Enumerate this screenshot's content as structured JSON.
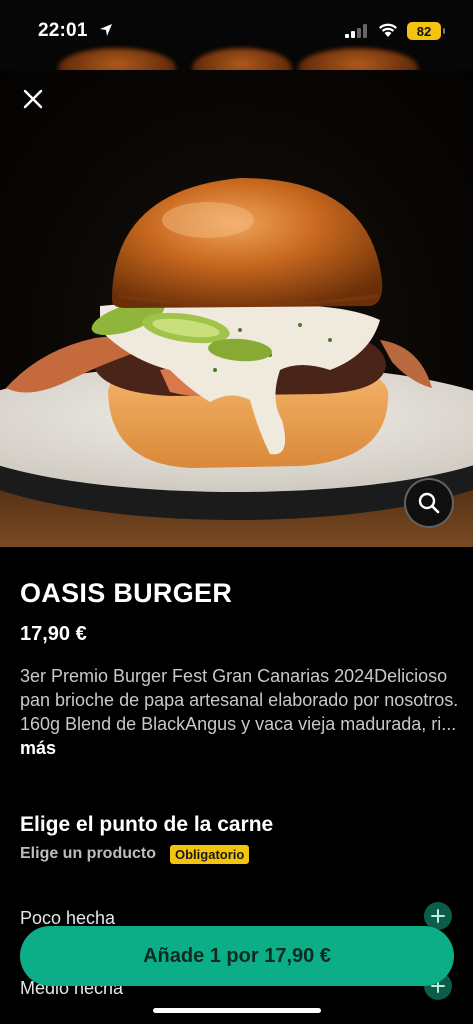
{
  "status_bar": {
    "time": "22:01",
    "battery": "82",
    "battery_color": "#f3c40e"
  },
  "hero": {
    "close_icon": "close-icon",
    "zoom_icon": "search-icon"
  },
  "product": {
    "name": "OASIS BURGER",
    "price": "17,90 €",
    "description": "3er Premio Burger Fest Gran Canarias 2024Delicioso pan brioche de papa artesanal elaborado por nosotros. 160g Blend de BlackAngus y vaca vieja madurada, ri...",
    "more_label": "más"
  },
  "options_section": {
    "title": "Elige el punto de la carne",
    "subtitle": "Elige un producto",
    "required_label": "Obligatorio",
    "items": [
      {
        "label": "Poco hecha"
      },
      {
        "label": "Medio hecha"
      }
    ]
  },
  "cta": {
    "label": "Añade 1 por 17,90 €",
    "color": "#0cae87"
  }
}
